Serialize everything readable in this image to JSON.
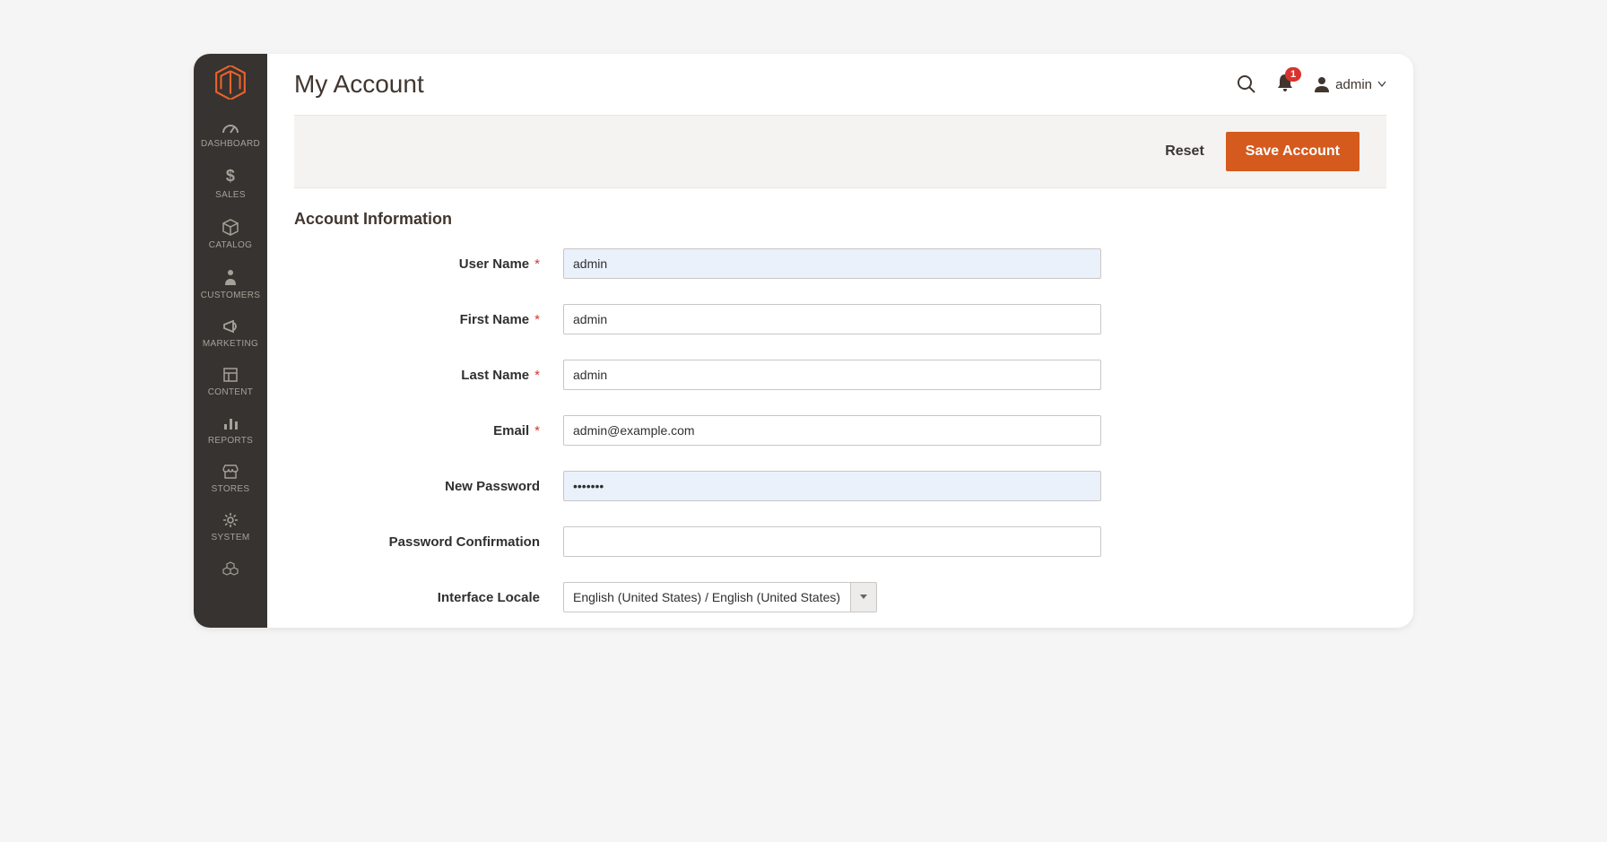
{
  "header": {
    "title": "My Account",
    "notification_count": "1",
    "username": "admin"
  },
  "actions": {
    "reset_label": "Reset",
    "save_label": "Save Account"
  },
  "sidebar": {
    "items": [
      {
        "label": "DASHBOARD"
      },
      {
        "label": "SALES"
      },
      {
        "label": "CATALOG"
      },
      {
        "label": "CUSTOMERS"
      },
      {
        "label": "MARKETING"
      },
      {
        "label": "CONTENT"
      },
      {
        "label": "REPORTS"
      },
      {
        "label": "STORES"
      },
      {
        "label": "SYSTEM"
      }
    ]
  },
  "section": {
    "title": "Account Information",
    "fields": {
      "username": {
        "label": "User Name",
        "value": "admin",
        "required": true
      },
      "firstname": {
        "label": "First Name",
        "value": "admin",
        "required": true
      },
      "lastname": {
        "label": "Last Name",
        "value": "admin",
        "required": true
      },
      "email": {
        "label": "Email",
        "value": "admin@example.com",
        "required": true
      },
      "newpassword": {
        "label": "New Password",
        "value": "•••••••"
      },
      "passwordconfirm": {
        "label": "Password Confirmation",
        "value": ""
      },
      "locale": {
        "label": "Interface Locale",
        "value": "English (United States) / English (United States)"
      }
    }
  }
}
